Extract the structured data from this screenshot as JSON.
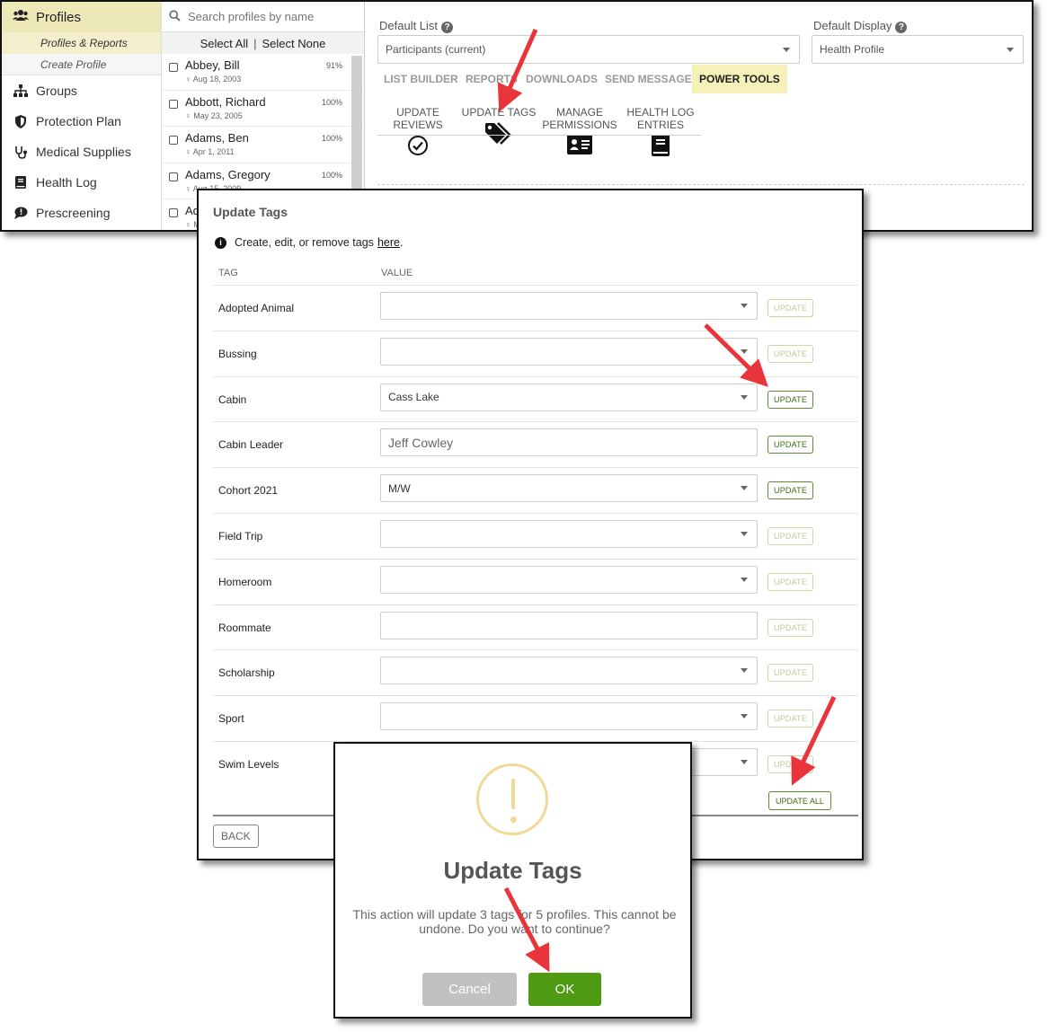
{
  "sidebar": {
    "profiles_label": "Profiles",
    "sub_items": [
      "Profiles & Reports",
      "Create Profile"
    ],
    "items": [
      {
        "label": "Groups",
        "icon": "sitemap-icon"
      },
      {
        "label": "Protection Plan",
        "icon": "shield-icon"
      },
      {
        "label": "Medical Supplies",
        "icon": "stethoscope-icon"
      },
      {
        "label": "Health Log",
        "icon": "book-icon"
      },
      {
        "label": "Prescreening",
        "icon": "chat-icon"
      }
    ]
  },
  "list": {
    "search_placeholder": "Search profiles by name",
    "select_all": "Select All",
    "separator": "|",
    "select_none": "Select None",
    "people": [
      {
        "name": "Abbey, Bill",
        "dob": "Aug 18, 2003",
        "pct": "91%"
      },
      {
        "name": "Abbott, Richard",
        "dob": "May 23, 2005",
        "pct": "100%"
      },
      {
        "name": "Adams, Ben",
        "dob": "Apr 1, 2011",
        "pct": "100%"
      },
      {
        "name": "Adams, Gregory",
        "dob": "Aug 15, 2009",
        "pct": "100%"
      },
      {
        "name": "Ad",
        "dob": "M",
        "pct": ""
      }
    ]
  },
  "main": {
    "default_list_label": "Default List",
    "default_list_value": "Participants (current)",
    "default_display_label": "Default Display",
    "default_display_value": "Health Profile",
    "help_glyph": "?",
    "tabs": [
      "LIST BUILDER",
      "REPORTS",
      "DOWNLOADS",
      "SEND MESSAGE",
      "POWER TOOLS"
    ],
    "tools": [
      {
        "line1": "UPDATE",
        "line2": "REVIEWS",
        "icon": "check-circle-icon"
      },
      {
        "line1": "UPDATE TAGS",
        "line2": "",
        "icon": "tags-icon"
      },
      {
        "line1": "MANAGE",
        "line2": "PERMISSIONS",
        "icon": "id-card-icon"
      },
      {
        "line1": "HEALTH LOG",
        "line2": "ENTRIES",
        "icon": "book-icon"
      }
    ]
  },
  "tags_modal": {
    "title": "Update Tags",
    "info_icon": "i",
    "info_text": "Create, edit, or remove tags",
    "info_link": "here",
    "info_end": ".",
    "col_tag": "TAG",
    "col_value": "VALUE",
    "update_label": "UPDATE",
    "update_all_label": "UPDATE ALL",
    "back_label": "BACK",
    "rows": [
      {
        "tag": "Adopted Animal",
        "value": "",
        "kind": "select",
        "active": false
      },
      {
        "tag": "Bussing",
        "value": "",
        "kind": "select",
        "active": false
      },
      {
        "tag": "Cabin",
        "value": "Cass Lake",
        "kind": "select",
        "active": true
      },
      {
        "tag": "Cabin Leader",
        "value": "Jeff Cowley",
        "kind": "text",
        "active": true
      },
      {
        "tag": "Cohort 2021",
        "value": "M/W",
        "kind": "select",
        "active": true
      },
      {
        "tag": "Field Trip",
        "value": "",
        "kind": "select",
        "active": false
      },
      {
        "tag": "Homeroom",
        "value": "",
        "kind": "select",
        "active": false
      },
      {
        "tag": "Roommate",
        "value": "",
        "kind": "text",
        "active": false
      },
      {
        "tag": "Scholarship",
        "value": "",
        "kind": "select",
        "active": false
      },
      {
        "tag": "Sport",
        "value": "",
        "kind": "select",
        "active": false
      },
      {
        "tag": "Swim Levels",
        "value": "",
        "kind": "select",
        "active": false
      }
    ]
  },
  "confirm": {
    "icon": "warning-icon",
    "title": "Update Tags",
    "text": "This action will update 3 tags for 5 profiles. This cannot be undone. Do you want to continue?",
    "cancel": "Cancel",
    "ok": "OK"
  },
  "colors": {
    "accent_yellow": "#ede8b8",
    "ok_green": "#4e9a12",
    "annotation_red": "#e8343a"
  }
}
